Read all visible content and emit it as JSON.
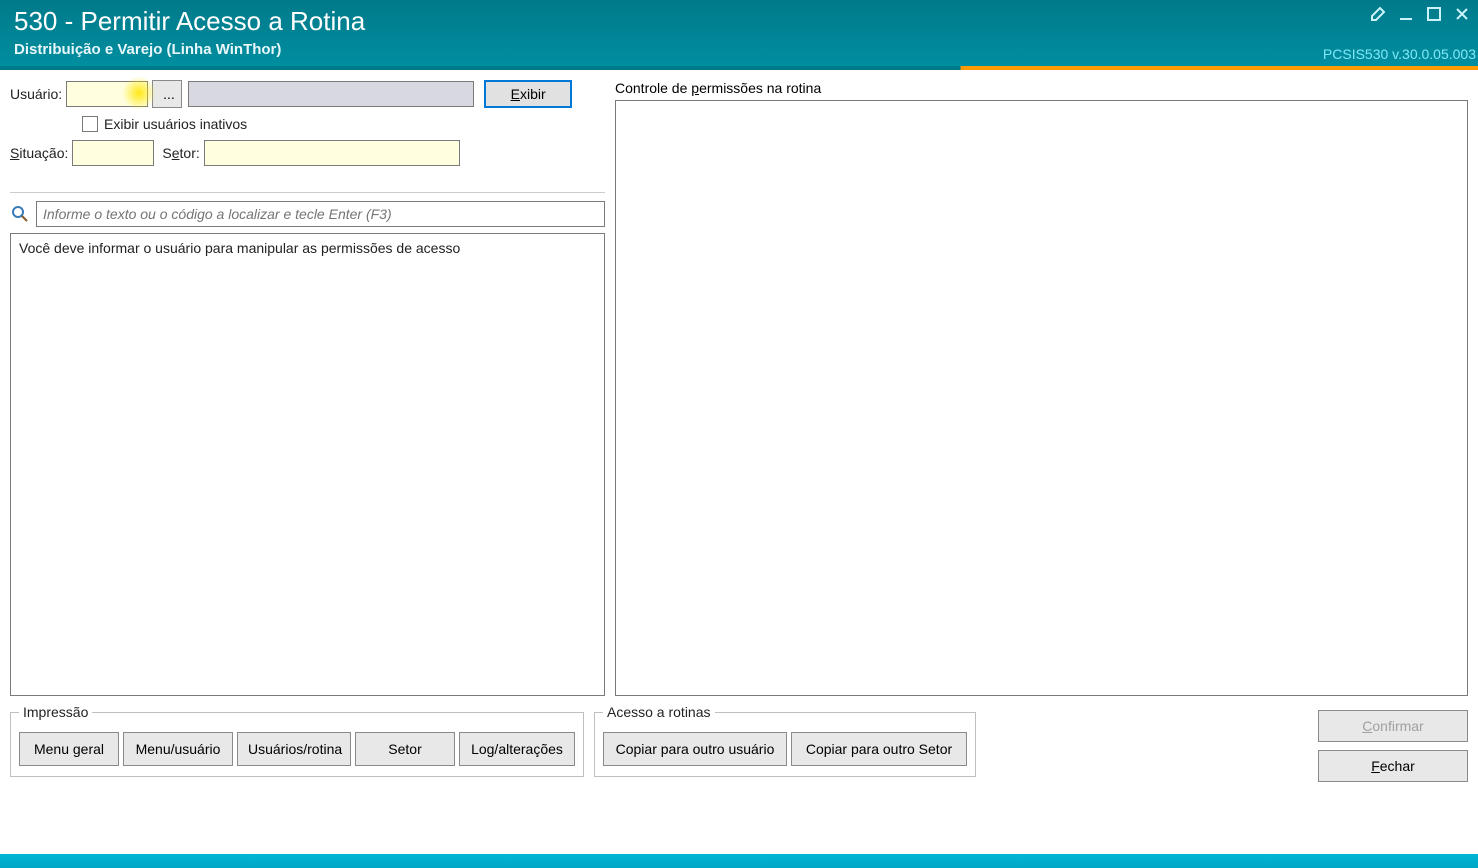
{
  "titlebar": {
    "title": "530 - Permitir Acesso a Rotina",
    "subtitle": "Distribuição e Varejo (Linha WinThor)",
    "version": "PCSIS530  v.30.0.05.003"
  },
  "form": {
    "usuario_label": "Usuário:",
    "ellipsis": "...",
    "exibir_btn": "Exibir",
    "inativos_checkbox": "Exibir usuários inativos",
    "situacao_label": "Situação:",
    "setor_label": "Setor:",
    "search_placeholder": "Informe o texto ou o código a localizar e tecle Enter (F3)",
    "list_message": "Você deve informar o usuário para manipular as permissões de acesso"
  },
  "right": {
    "permissoes_label": "Controle de permissões na rotina"
  },
  "groups": {
    "impressao": {
      "legend": "Impressão",
      "menu_geral": "Menu geral",
      "menu_usuario": "Menu/usuário",
      "usuarios_rotina": "Usuários/rotina",
      "setor": "Setor",
      "log_alteracoes": "Log/alterações"
    },
    "acesso": {
      "legend": "Acesso a rotinas",
      "copiar_usuario": "Copiar para outro usuário",
      "copiar_setor": "Copiar para outro Setor"
    }
  },
  "actions": {
    "confirmar": "Confirmar",
    "fechar": "Fechar"
  }
}
